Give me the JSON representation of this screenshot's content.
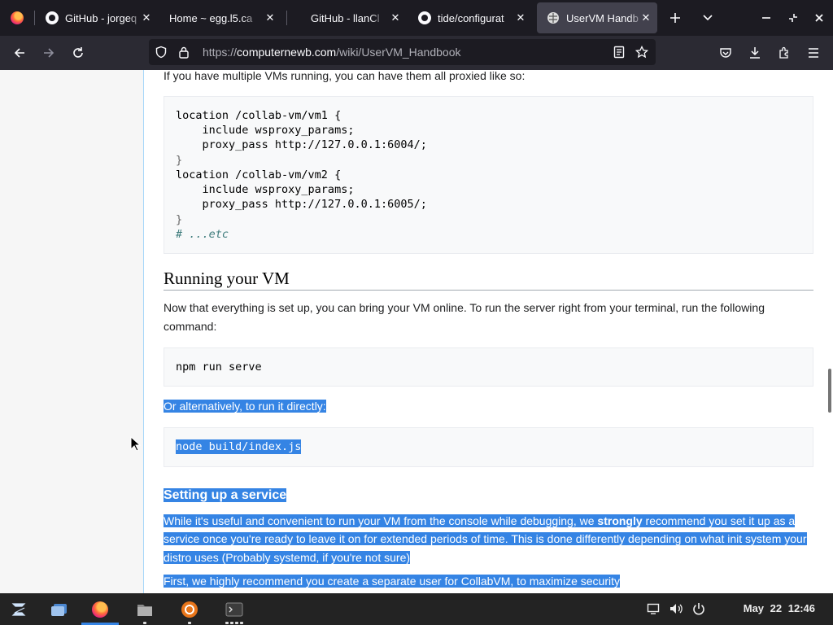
{
  "browser": {
    "tabs": [
      {
        "label": "GitHub - jorgeq",
        "icon": "github-icon"
      },
      {
        "label": "Home ~ egg.l5.ca",
        "icon": "none"
      },
      {
        "label": "GitHub - llanCl",
        "icon": "none"
      },
      {
        "label": "tide/configurat",
        "icon": "github-icon"
      },
      {
        "label": "UserVM Handb",
        "icon": "wiki-icon",
        "active": true
      }
    ],
    "url": {
      "scheme": "https://",
      "host": "computernewb.com",
      "path": "/wiki/UserVM_Handbook"
    }
  },
  "article": {
    "intro_proxy": "If you have multiple VMs running, you can have them all proxied like so:",
    "code_proxy": [
      "location /collab-vm/vm1 {",
      "    include wsproxy_params;",
      "    proxy_pass http://127.0.0.1:6004/;",
      "}",
      "location /collab-vm/vm2 {",
      "    include wsproxy_params;",
      "    proxy_pass http://127.0.0.1:6005/;",
      "}",
      "# ...etc"
    ],
    "heading_running": "Running your VM",
    "running_text_1": "Now that everything is set up, you can bring your VM online. To run the server right from your terminal, run the following",
    "running_text_2": "command:",
    "code_serve": "npm run serve",
    "alt_text": "Or alternatively, to run it directly:",
    "code_node": "node build/index.js",
    "heading_service": "Setting up a service",
    "service_line_1a": "While it's useful and convenient to run your VM from the console while debugging, we ",
    "service_line_1b": "strongly",
    "service_line_1c": " recommend you set it up as a",
    "service_line_2": "service once you're ready to leave it on for extended periods of time. This is done differently depending on what init system your",
    "service_line_3": "distro uses (Probably systemd, if you're not sure)",
    "service_user": "First, we highly recommend you create a separate user for CollabVM, to maximize security"
  },
  "taskbar": {
    "clock_date": "May 22",
    "clock_time": "12:46"
  },
  "colors": {
    "selection": "#3584e4",
    "tabbar_bg": "#1c1b22",
    "navbar_bg": "#2b2a33"
  }
}
